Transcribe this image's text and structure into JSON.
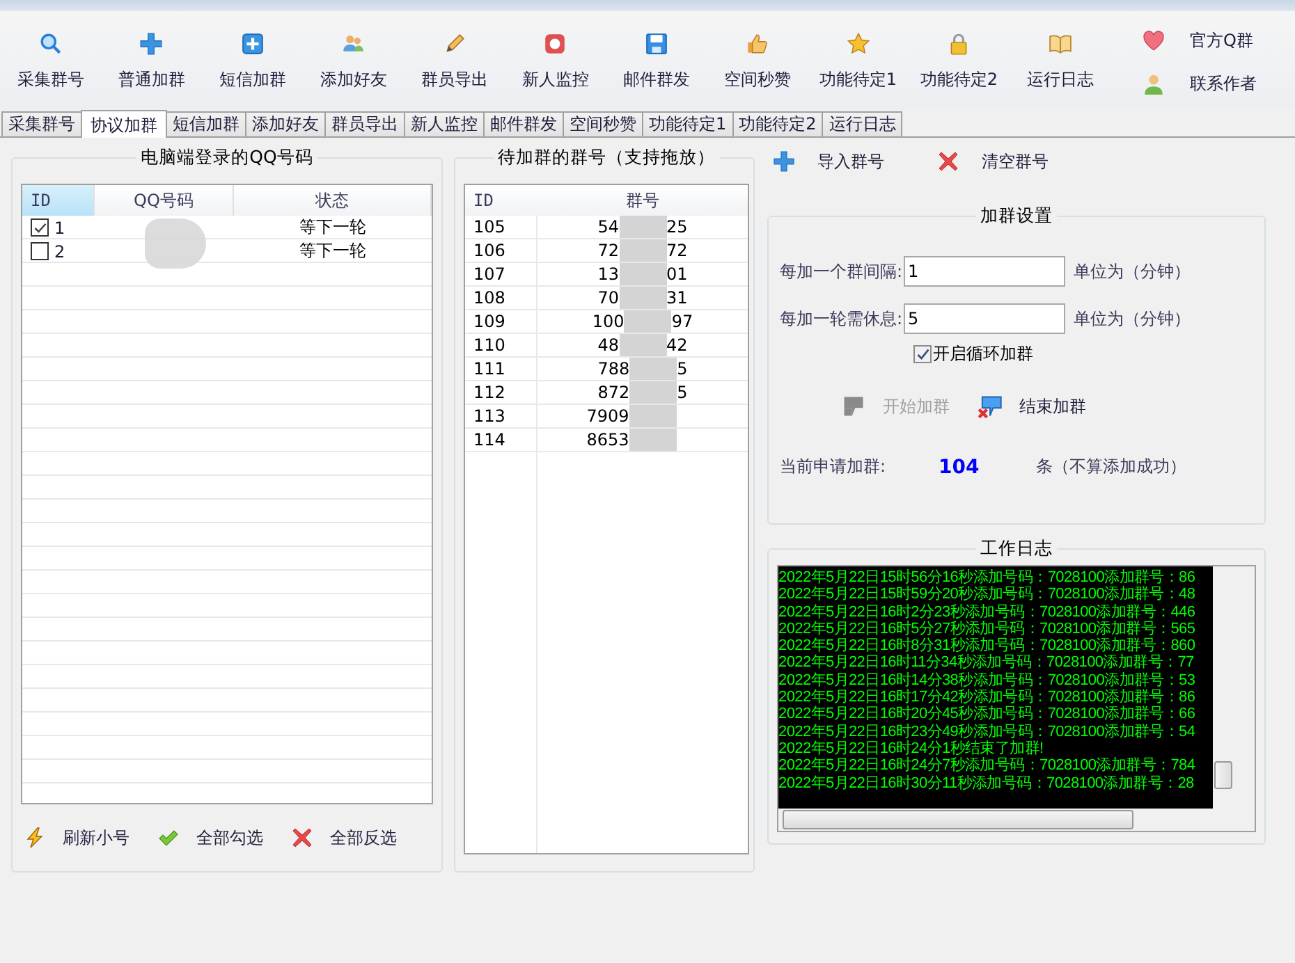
{
  "toolbar": {
    "buttons": [
      {
        "label": "采集群号"
      },
      {
        "label": "普通加群"
      },
      {
        "label": "短信加群"
      },
      {
        "label": "添加好友"
      },
      {
        "label": "群员导出"
      },
      {
        "label": "新人监控"
      },
      {
        "label": "邮件群发"
      },
      {
        "label": "空间秒赞"
      },
      {
        "label": "功能待定1"
      },
      {
        "label": "功能待定2"
      },
      {
        "label": "运行日志"
      }
    ],
    "side_links": [
      {
        "label": "官方Q群"
      },
      {
        "label": "联系作者"
      }
    ]
  },
  "tabs": [
    {
      "label": "采集群号",
      "selected": false
    },
    {
      "label": "协议加群",
      "selected": true
    },
    {
      "label": "短信加群",
      "selected": false
    },
    {
      "label": "添加好友",
      "selected": false
    },
    {
      "label": "群员导出",
      "selected": false
    },
    {
      "label": "新人监控",
      "selected": false
    },
    {
      "label": "邮件群发",
      "selected": false
    },
    {
      "label": "空间秒赞",
      "selected": false
    },
    {
      "label": "功能待定1",
      "selected": false
    },
    {
      "label": "功能待定2",
      "selected": false
    },
    {
      "label": "运行日志",
      "selected": false
    }
  ],
  "accounts": {
    "title": "电脑端登录的QQ号码",
    "columns": [
      {
        "label": "ID",
        "sorted": true
      },
      {
        "label": "QQ号码",
        "sorted": false
      },
      {
        "label": "状态",
        "sorted": false
      }
    ],
    "rows": [
      {
        "checked": true,
        "id": "1",
        "status": "等下一轮"
      },
      {
        "checked": false,
        "id": "2",
        "status": "等下一轮"
      }
    ],
    "buttons": [
      {
        "label": "刷新小号"
      },
      {
        "label": "全部勾选"
      },
      {
        "label": "全部反选"
      }
    ]
  },
  "groups": {
    "title": "待加群的群号（支持拖放）",
    "columns": [
      "ID",
      "群号"
    ],
    "rows": [
      {
        "id": "105",
        "number_start": "54",
        "number_end": "25"
      },
      {
        "id": "106",
        "number_start": "72",
        "number_end": "72"
      },
      {
        "id": "107",
        "number_start": "13",
        "number_end": "01"
      },
      {
        "id": "108",
        "number_start": "70",
        "number_end": "31"
      },
      {
        "id": "109",
        "number_start": "100",
        "number_end": "97"
      },
      {
        "id": "110",
        "number_start": "48",
        "number_end": "42"
      },
      {
        "id": "111",
        "number_start": "788",
        "number_end": "5"
      },
      {
        "id": "112",
        "number_start": "872",
        "number_end": "5"
      },
      {
        "id": "113",
        "number_start": "7909"
      },
      {
        "id": "114",
        "number_start": "8653"
      }
    ]
  },
  "actions": [
    {
      "label": "导入群号"
    },
    {
      "label": "清空群号"
    }
  ],
  "settings": {
    "title": "加群设置",
    "fields": [
      {
        "label": "每加一个群间隔:",
        "value": "1",
        "unit": "单位为（分钟）"
      },
      {
        "label": "每加一轮需休息:",
        "value": "5",
        "unit": "单位为（分钟）"
      }
    ],
    "loop": {
      "label": "开启循环加群",
      "checked": true
    },
    "buttons": [
      {
        "label": "开始加群",
        "disabled": true
      },
      {
        "label": "结束加群",
        "disabled": false
      }
    ],
    "count": {
      "label": "当前申请加群:",
      "value": "104",
      "note": "条（不算添加成功）"
    }
  },
  "log": {
    "title": "工作日志",
    "lines": [
      "2022年5月22日15时56分16秒添加号码：7028100添加群号：86",
      "2022年5月22日15时59分20秒添加号码：7028100添加群号：48",
      "2022年5月22日16时2分23秒添加号码：7028100添加群号：446",
      "2022年5月22日16时5分27秒添加号码：7028100添加群号：565",
      "2022年5月22日16时8分31秒添加号码：7028100添加群号：860",
      "2022年5月22日16时11分34秒添加号码：7028100添加群号：77",
      "2022年5月22日16时14分38秒添加号码：7028100添加群号：53",
      "2022年5月22日16时17分42秒添加号码：7028100添加群号：86",
      "2022年5月22日16时20分45秒添加号码：7028100添加群号：66",
      "2022年5月22日16时23分49秒添加号码：7028100添加群号：54",
      "2022年5月22日16时24分1秒结束了加群!",
      "2022年5月22日16时24分7秒添加号码：7028100添加群号：784",
      "2022年5月22日16时30分11秒添加号码：7028100添加群号：28"
    ]
  }
}
